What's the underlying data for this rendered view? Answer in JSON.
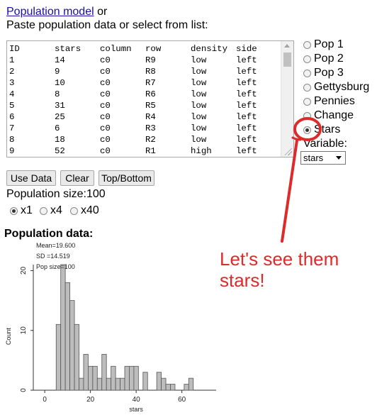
{
  "header": {
    "link_text": "Population model",
    "link_suffix": " or",
    "instruction": "Paste population data or select from list:"
  },
  "data_table": {
    "columns": [
      "ID",
      "stars",
      "column",
      "row",
      "density",
      "side"
    ],
    "rows": [
      [
        "1",
        "14",
        "c0",
        "R9",
        "low",
        "left"
      ],
      [
        "2",
        "9",
        "c0",
        "R8",
        "low",
        "left"
      ],
      [
        "3",
        "10",
        "c0",
        "R7",
        "low",
        "left"
      ],
      [
        "4",
        "8",
        "c0",
        "R6",
        "low",
        "left"
      ],
      [
        "5",
        "31",
        "c0",
        "R5",
        "low",
        "left"
      ],
      [
        "6",
        "25",
        "c0",
        "R4",
        "low",
        "left"
      ],
      [
        "7",
        "6",
        "c0",
        "R3",
        "low",
        "left"
      ],
      [
        "8",
        "18",
        "c0",
        "R2",
        "low",
        "left"
      ],
      [
        "9",
        "52",
        "c0",
        "R1",
        "high",
        "left"
      ]
    ]
  },
  "populations": [
    {
      "label": "Pop 1",
      "selected": false
    },
    {
      "label": "Pop 2",
      "selected": false
    },
    {
      "label": "Pop 3",
      "selected": false
    },
    {
      "label": "Gettysburg",
      "selected": false
    },
    {
      "label": "Pennies",
      "selected": false
    },
    {
      "label": "Change",
      "selected": false
    },
    {
      "label": "Stars",
      "selected": true
    }
  ],
  "variable": {
    "label": "Variable:",
    "selected": "stars"
  },
  "buttons": {
    "use_data": "Use Data",
    "clear": "Clear",
    "top_bottom": "Top/Bottom"
  },
  "population_size": "Population size:100",
  "multipliers": [
    {
      "label": "x1",
      "selected": true
    },
    {
      "label": "x4",
      "selected": false
    },
    {
      "label": "x40",
      "selected": false
    }
  ],
  "population_data_title": "Population data:",
  "callout": "Let's see them stars!",
  "colors": {
    "bar_fill": "#bdbdbd",
    "bar_stroke": "#555555",
    "callout": "#dd2a2a",
    "link": "#1a0dab"
  },
  "chart_data": {
    "type": "bar",
    "stats": [
      "Mean=19.600",
      "SD =14.519",
      "Pop size=100"
    ],
    "xlabel": "stars",
    "ylabel": "Count",
    "xlim": [
      -5,
      75
    ],
    "ylim": [
      0,
      21
    ],
    "xticks": [
      0,
      20,
      40,
      60
    ],
    "yticks": [
      0,
      10,
      20
    ],
    "bin_width": 2,
    "bins": [
      {
        "x0": 5,
        "count": 11
      },
      {
        "x0": 7,
        "count": 21
      },
      {
        "x0": 9,
        "count": 18
      },
      {
        "x0": 11,
        "count": 15
      },
      {
        "x0": 13,
        "count": 11
      },
      {
        "x0": 15,
        "count": 2
      },
      {
        "x0": 17,
        "count": 6
      },
      {
        "x0": 19,
        "count": 4
      },
      {
        "x0": 21,
        "count": 4
      },
      {
        "x0": 23,
        "count": 2
      },
      {
        "x0": 25,
        "count": 6
      },
      {
        "x0": 27,
        "count": 2
      },
      {
        "x0": 29,
        "count": 4
      },
      {
        "x0": 31,
        "count": 2
      },
      {
        "x0": 33,
        "count": 2
      },
      {
        "x0": 35,
        "count": 4
      },
      {
        "x0": 37,
        "count": 4
      },
      {
        "x0": 39,
        "count": 4
      },
      {
        "x0": 43,
        "count": 3
      },
      {
        "x0": 49,
        "count": 3
      },
      {
        "x0": 51,
        "count": 2
      },
      {
        "x0": 53,
        "count": 1
      },
      {
        "x0": 55,
        "count": 1
      },
      {
        "x0": 61,
        "count": 1
      },
      {
        "x0": 63,
        "count": 2
      }
    ]
  }
}
